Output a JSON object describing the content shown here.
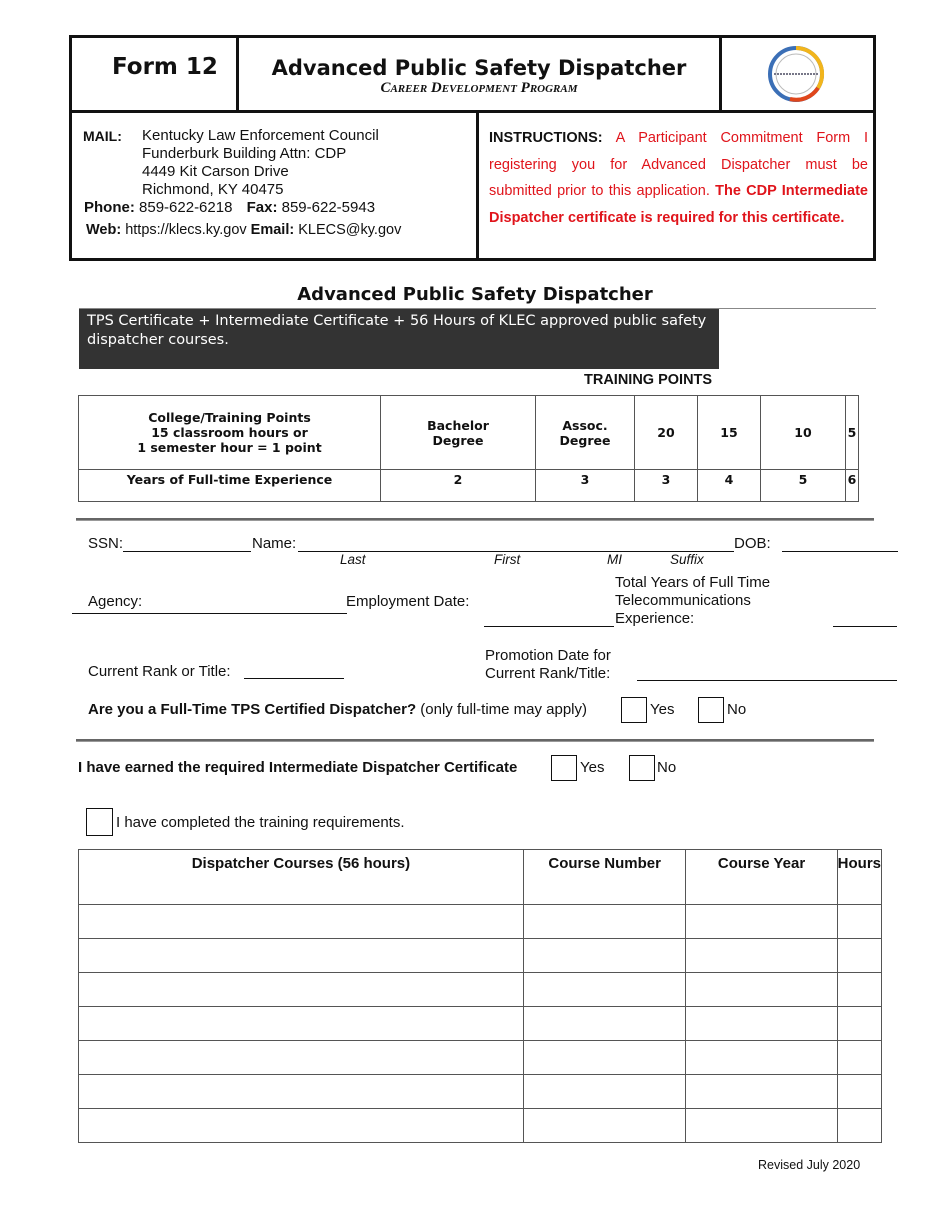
{
  "header": {
    "form_number": "Form 12",
    "title": "Advanced Public Safety Dispatcher",
    "subtitle": "Career Development Program",
    "logo": "cdp-seal-logo"
  },
  "contact": {
    "mail_label": "MAIL:",
    "address_lines": [
      "Kentucky Law Enforcement Council",
      "Funderburk Building Attn: CDP",
      "4449 Kit Carson Drive",
      "Richmond, KY  40475"
    ],
    "phone_label": "Phone:",
    "phone": "859-622-6218",
    "fax_label": "Fax:",
    "fax": "859-622-5943",
    "web_label": "Web:",
    "web": "https://klecs.ky.gov",
    "email_label": "Email:",
    "email": "KLECS@ky.gov"
  },
  "instructions": {
    "label": "INSTRUCTIONS:",
    "text": "A Participant Commitment Form I registering you for Advanced Dispatcher must be submitted prior to this application.",
    "bold_text": "The CDP Intermediate Dispatcher certificate is required for this certificate.",
    "color": "#e0141b"
  },
  "section": {
    "title": "Advanced Public Safety Dispatcher",
    "requirement": "TPS Certificate + Intermediate Certificate + 56 Hours of KLEC approved public safety dispatcher courses.",
    "training_points_label": "TRAINING POINTS"
  },
  "points_table": {
    "row1_label": [
      "College/Training Points",
      "15 classroom hours or",
      "1 semester hour = 1 point"
    ],
    "row1": [
      "Bachelor Degree",
      "Assoc. Degree",
      "20",
      "15",
      "10",
      "5"
    ],
    "row2_label": "Years of Full-time Experience",
    "row2": [
      "2",
      "3",
      "3",
      "4",
      "5",
      "6"
    ]
  },
  "fields": {
    "ssn": "SSN:",
    "name": "Name:",
    "dob": "DOB:",
    "name_parts": [
      "Last",
      "First",
      "MI",
      "Suffix"
    ],
    "agency": "Agency:",
    "employment_date": "Employment Date:",
    "total_years": [
      "Total Years of Full Time",
      "Telecommunications",
      "Experience:"
    ],
    "current_rank": "Current Rank or Title:",
    "promotion_date": [
      "Promotion Date for",
      "Current Rank/Title:"
    ],
    "fulltime_question": "Are you a Full-Time TPS Certified Dispatcher?",
    "fulltime_note": "(only full-time may apply)",
    "yes": "Yes",
    "no": "No",
    "intermediate_question": "I have earned the required Intermediate Dispatcher Certificate",
    "training_completed": "I have completed the training requirements."
  },
  "courses_table": {
    "headers": [
      "Dispatcher Courses (56 hours)",
      "Course Number",
      "Course Year",
      "Hours"
    ],
    "rows": [
      [
        "",
        "",
        "",
        ""
      ],
      [
        "",
        "",
        "",
        ""
      ],
      [
        "",
        "",
        "",
        ""
      ],
      [
        "",
        "",
        "",
        ""
      ],
      [
        "",
        "",
        "",
        ""
      ],
      [
        "",
        "",
        "",
        ""
      ],
      [
        "",
        "",
        "",
        ""
      ]
    ]
  },
  "footer": {
    "revised": "Revised July 2020"
  }
}
